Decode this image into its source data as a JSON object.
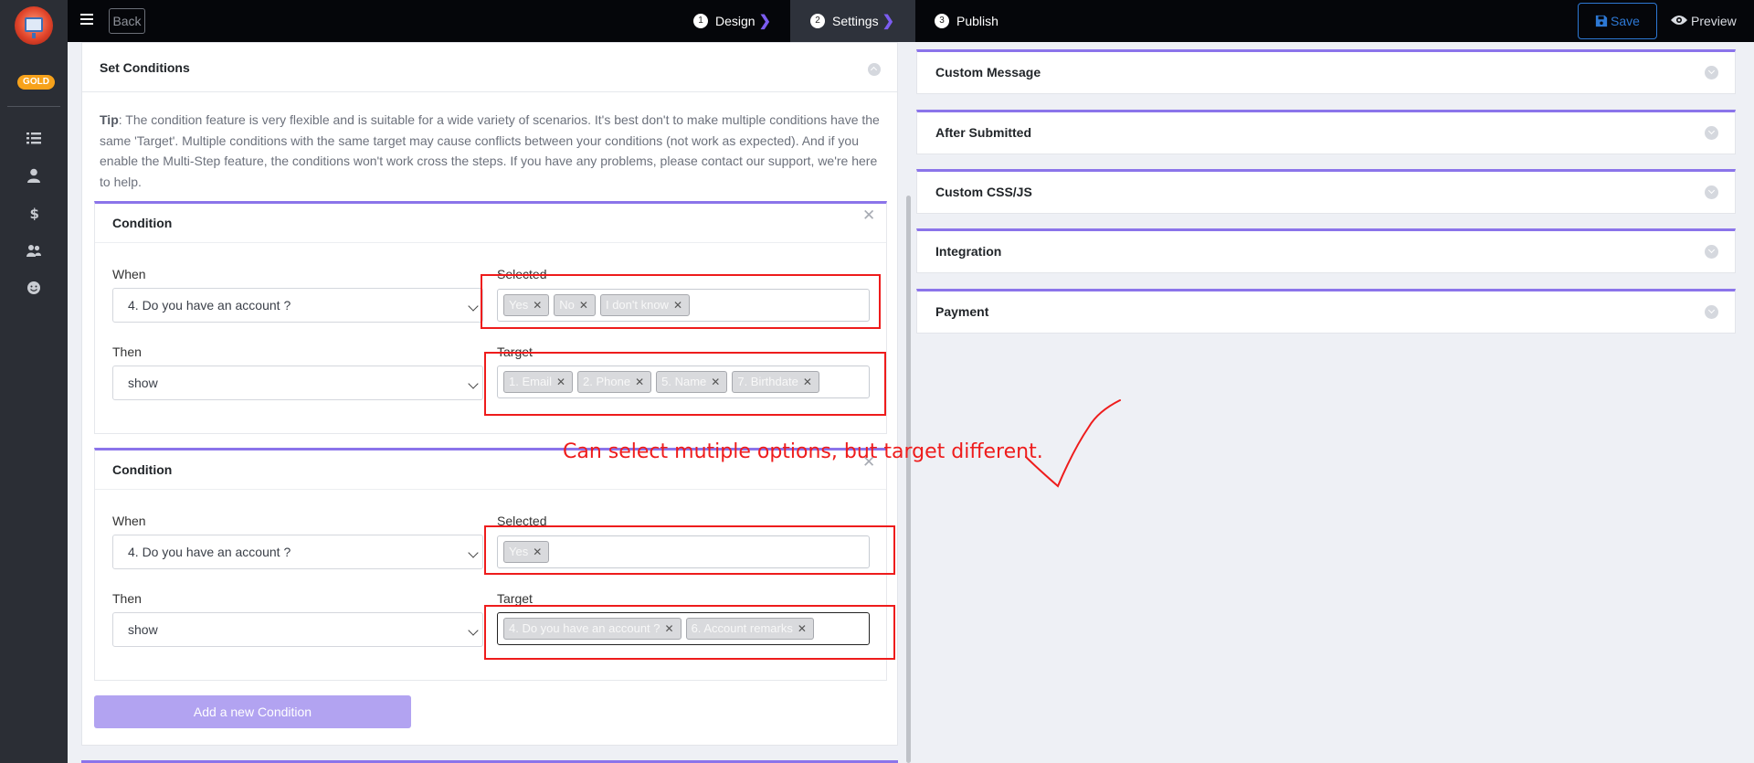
{
  "sidebar": {
    "badge": "GOLD",
    "icons": [
      "list-icon",
      "user-icon",
      "dollar-icon",
      "users-icon",
      "smile-icon"
    ]
  },
  "topbar": {
    "back_label": "Back",
    "steps": [
      {
        "num": "1",
        "label": "Design",
        "active": false
      },
      {
        "num": "2",
        "label": "Settings",
        "active": true
      },
      {
        "num": "3",
        "label": "Publish",
        "active": false
      }
    ],
    "save_label": "Save",
    "preview_label": "Preview"
  },
  "set_conditions": {
    "title": "Set Conditions",
    "tip_label": "Tip",
    "tip_text": ": The condition feature is very flexible and is suitable for a wide variety of scenarios. It's best don't to make multiple conditions have the same 'Target'. Multiple conditions with the same target may cause conflicts between your conditions (not work as expected). And if you enable the Multi-Step feature, the conditions won't work cross the steps. If you have any problems, please contact our support, we're here to help.",
    "conditions": [
      {
        "title": "Condition",
        "when_label": "When",
        "when_value": "4. Do you have an account ?",
        "selected_label": "Selected",
        "selected_tags": [
          "Yes",
          "No",
          "I don't know"
        ],
        "then_label": "Then",
        "then_value": "show",
        "target_label": "Target",
        "target_tags": [
          "1. Email",
          "2. Phone",
          "5. Name",
          "7. Birthdate"
        ]
      },
      {
        "title": "Condition",
        "when_label": "When",
        "when_value": "4. Do you have an account ?",
        "selected_label": "Selected",
        "selected_tags": [
          "Yes"
        ],
        "then_label": "Then",
        "then_value": "show",
        "target_label": "Target",
        "target_tags": [
          "4. Do you have an account ?",
          "6. Account remarks"
        ]
      }
    ],
    "add_button": "Add a new Condition"
  },
  "right_panels": [
    "Custom Message",
    "After Submitted",
    "Custom CSS/JS",
    "Integration",
    "Payment"
  ],
  "annotation": {
    "text": "Can select mutiple options, but target different.",
    "color": "#ee1c1c"
  },
  "colors": {
    "accent": "#8b74ea",
    "save": "#2d78d4",
    "badge": "#f7a21b"
  }
}
